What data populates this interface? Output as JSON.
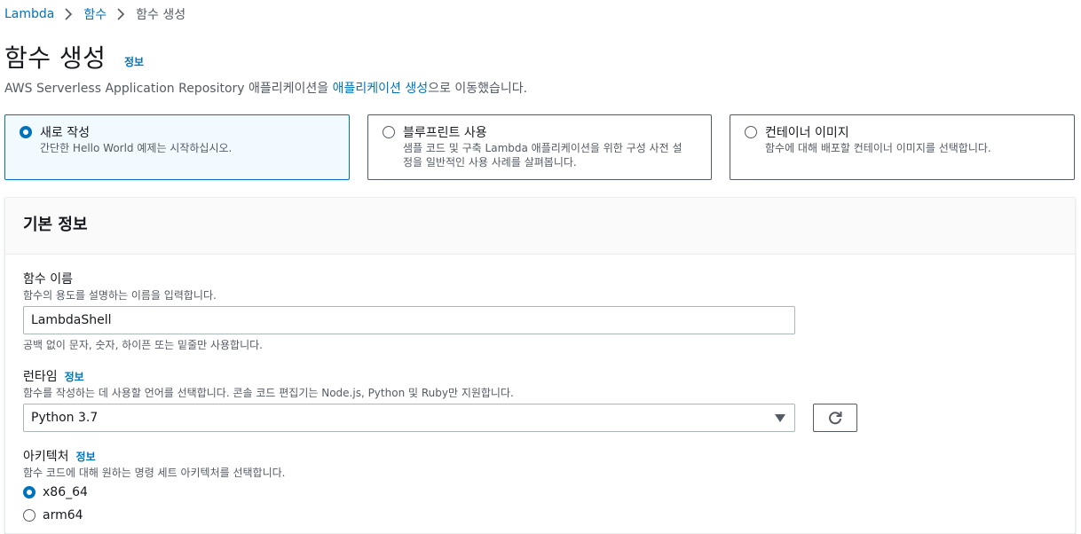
{
  "breadcrumb": {
    "items": [
      {
        "label": "Lambda"
      },
      {
        "label": "함수"
      },
      {
        "label": "함수 생성"
      }
    ]
  },
  "header": {
    "title": "함수 생성",
    "info_link": "정보",
    "subtitle_prefix": "AWS Serverless Application Repository 애플리케이션을 ",
    "subtitle_link": "애플리케이션 생성",
    "subtitle_suffix": "으로 이동했습니다."
  },
  "options": [
    {
      "title": "새로 작성",
      "desc": "간단한 Hello World 예제는 시작하십시오.",
      "selected": true
    },
    {
      "title": "블루프린트 사용",
      "desc_line1": "샘플 코드 및 구축 Lambda 애플리케이션을 위한 구성 사전 설",
      "desc_line2": "정을 일반적인 사용 사례를 살펴봅니다.",
      "selected": false
    },
    {
      "title": "컨테이너 이미지",
      "desc": "함수에 대해 배포할 컨테이너 이미지를 선택합니다.",
      "selected": false
    }
  ],
  "basic_info": {
    "title": "기본 정보",
    "function_name": {
      "label": "함수 이름",
      "desc": "함수의 용도를 설명하는 이름을 입력합니다.",
      "value": "LambdaShell",
      "hint": "공백 없이 문자, 숫자, 하이픈 또는 밑줄만 사용합니다."
    },
    "runtime": {
      "label": "런타임",
      "info": "정보",
      "desc": "함수를 작성하는 데 사용할 언어를 선택합니다. 콘솔 코드 편집기는 Node.js, Python 및 Ruby만 지원합니다.",
      "value": "Python 3.7"
    },
    "architecture": {
      "label": "아키텍처",
      "info": "정보",
      "desc": "함수 코드에 대해 원하는 명령 세트 아키텍처를 선택합니다.",
      "options": [
        {
          "label": "x86_64",
          "selected": true
        },
        {
          "label": "arm64",
          "selected": false
        }
      ]
    }
  },
  "colors": {
    "link": "#0073bb",
    "text": "#16191f",
    "muted": "#545b64",
    "selected_bg": "#f1faff"
  }
}
